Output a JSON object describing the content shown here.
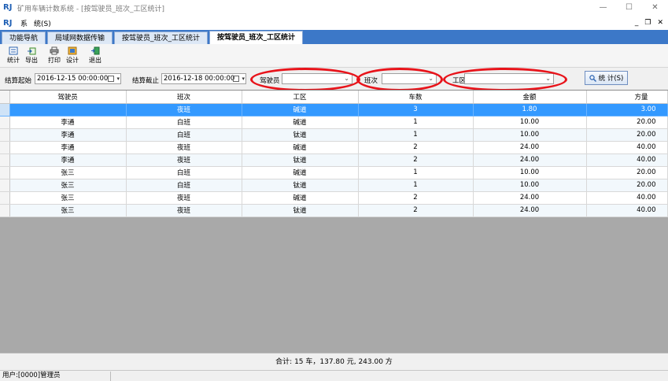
{
  "window": {
    "title": "矿用车辆计数系统 - [按驾驶员_班次_工区统计]",
    "minimize": "—",
    "maximize": "☐",
    "close": "✕"
  },
  "menu": {
    "logo": "RJ",
    "items": [
      "系",
      "统(S)"
    ],
    "mdi_min": "_",
    "mdi_restore": "❐",
    "mdi_close": "✕"
  },
  "tabs": [
    {
      "label": "功能导航",
      "active": false
    },
    {
      "label": "局域网数据传输",
      "active": false
    },
    {
      "label": "按驾驶员_班次_工区统计",
      "active": false
    },
    {
      "label": "按驾驶员_班次_工区统计",
      "active": true
    }
  ],
  "toolbar": {
    "stats": "统计",
    "export": "导出",
    "print": "打印",
    "design": "设计",
    "exit": "退出"
  },
  "filter": {
    "start_label": "结算起始",
    "start_value": "2016-12-15 00:00:00",
    "end_label": "结算截止",
    "end_value": "2016-12-18 00:00:00",
    "driver_label": "驾驶员",
    "driver_value": "",
    "shift_label": "班次",
    "shift_value": "",
    "area_label": "工区",
    "area_value": "",
    "stats_button": "统 计(S)"
  },
  "grid": {
    "columns": [
      "驾驶员",
      "班次",
      "工区",
      "车数",
      "金额",
      "方量"
    ],
    "rows": [
      [
        "",
        "夜班",
        "碱道",
        "3",
        "1.80",
        "3.00"
      ],
      [
        "李通",
        "白班",
        "碱道",
        "1",
        "10.00",
        "20.00"
      ],
      [
        "李通",
        "白班",
        "钛道",
        "1",
        "10.00",
        "20.00"
      ],
      [
        "李通",
        "夜班",
        "碱道",
        "2",
        "24.00",
        "40.00"
      ],
      [
        "李通",
        "夜班",
        "钛道",
        "2",
        "24.00",
        "40.00"
      ],
      [
        "张三",
        "白班",
        "碱道",
        "1",
        "10.00",
        "20.00"
      ],
      [
        "张三",
        "白班",
        "钛道",
        "1",
        "10.00",
        "20.00"
      ],
      [
        "张三",
        "夜班",
        "碱道",
        "2",
        "24.00",
        "40.00"
      ],
      [
        "张三",
        "夜班",
        "钛道",
        "2",
        "24.00",
        "40.00"
      ]
    ],
    "selected_row": 0
  },
  "summary": "合计: 15 车，137.80 元, 243.00 方",
  "status": {
    "user": "用户:[0000]管理员"
  },
  "colors": {
    "tab_bar": "#3c78c8",
    "selection": "#3399ff",
    "annotation_ring": "#e8131a",
    "grid_empty": "#a9a9a9"
  }
}
